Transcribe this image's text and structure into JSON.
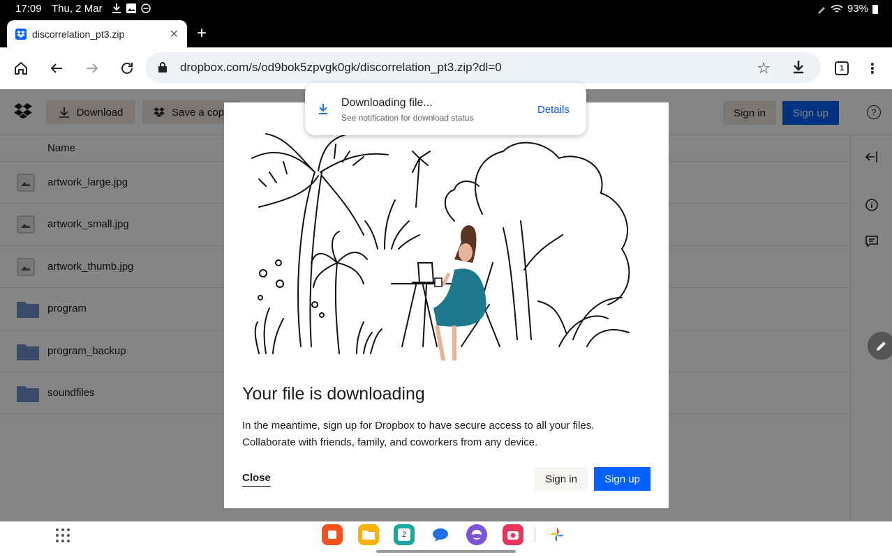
{
  "status_bar": {
    "time": "17:09",
    "date": "Thu, 2 Mar",
    "battery": "93%"
  },
  "browser": {
    "tab_title": "discorrelation_pt3.zip",
    "url": "dropbox.com/s/od9bok5zpvgk0gk/discorrelation_pt3.zip?dl=0",
    "tab_count": "1"
  },
  "header": {
    "download_label": "Download",
    "save_label": "Save a copy",
    "signin_label": "Sign in",
    "signup_label": "Sign up",
    "help_label": "?"
  },
  "file_list": {
    "column_name": "Name",
    "files": [
      {
        "name": "artwork_large.jpg",
        "type": "image"
      },
      {
        "name": "artwork_small.jpg",
        "type": "image"
      },
      {
        "name": "artwork_thumb.jpg",
        "type": "image"
      },
      {
        "name": "program",
        "type": "folder"
      },
      {
        "name": "program_backup",
        "type": "folder"
      },
      {
        "name": "soundfiles",
        "type": "folder"
      }
    ]
  },
  "toast": {
    "title": "Downloading file...",
    "subtitle": "See notification for download status",
    "details_label": "Details"
  },
  "modal": {
    "title": "Your file is downloading",
    "body_line1": "In the meantime, sign up for Dropbox to have secure access to all your files.",
    "body_line2": "Collaborate with friends, family, and coworkers from any device.",
    "close_label": "Close",
    "signin_label": "Sign in",
    "signup_label": "Sign up"
  },
  "dock": {
    "calendar_day": "2"
  },
  "colors": {
    "accent": "#0061fe",
    "button_beige": "#ece6dc",
    "folder_blue": "#6b8fc7"
  }
}
